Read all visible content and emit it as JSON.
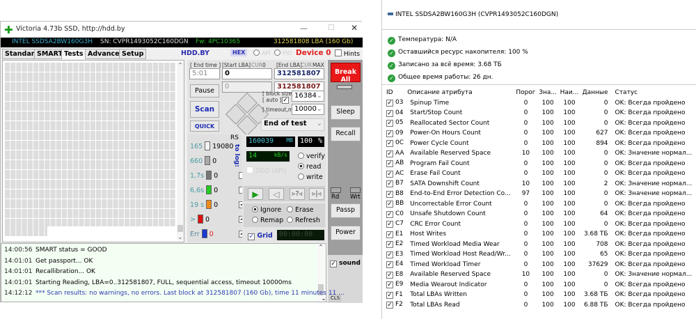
{
  "victoria": {
    "title": "Victoria 4.73b SSD, http://hdd.by",
    "info": {
      "model": "INTEL SSDSA2BW160G3H",
      "sn": "SN: CVPR1493052C160DGN",
      "fw": "Fw: 4PC10365",
      "lba": "312581808 LBA (160 Gb)"
    },
    "tabs": [
      "Standard",
      "SMART",
      "Tests",
      "Advanced",
      "Setup"
    ],
    "hddby": "HDD.BY",
    "hex": "HEX",
    "api": "API",
    "pio": "PIO",
    "device": "Device 0",
    "hints": "Hints",
    "end_time_label": "[ End time ]",
    "end_time": "5:01",
    "start_lba_label": "[Start LBA]",
    "cur": "CUR",
    "cur_val": "0",
    "end_lba_label": "[End LBA]",
    "max": "MAX",
    "start_lba": "0",
    "end_lba": "312581807",
    "start_lba2": "0",
    "end_lba2": "312581807",
    "pause": "Pause",
    "scan": "Scan",
    "quick": "QUICK",
    "block_size_label": "[ block size ]",
    "auto_label": "[ auto ]",
    "block_size": "16384",
    "timeout_label": "[ timeout,ms ]",
    "timeout": "10000",
    "end_action": "End of test",
    "rs": "RS",
    "to_log": "to log:",
    "legend": [
      {
        "label": "165",
        "count": "19080",
        "color": "#f4f4f4"
      },
      {
        "label": "660",
        "count": "0",
        "color": "#aaaaaa"
      },
      {
        "label": "1,7s",
        "count": "0",
        "color": "#777777"
      },
      {
        "label": "6,6s",
        "count": "0",
        "color": "#22cc22"
      },
      {
        "label": "19 s",
        "count": "0",
        "color": "#f08a1c"
      },
      {
        "label": ">",
        "count": "0",
        "color": "#e01010"
      },
      {
        "label": "Err",
        "count": "0",
        "color": "#1a3ad0"
      }
    ],
    "mb": "160039",
    "mb_unit": "MB",
    "pct": "100",
    "pct_unit": "%",
    "speed": "14",
    "speed_unit": "kB/s",
    "ddd": "DDD (API)",
    "modes": [
      "verify",
      "read",
      "write"
    ],
    "actions": [
      "Ignore",
      "Erase",
      "Remap",
      "Refresh"
    ],
    "grid": "Grid",
    "timer": "00:00:00",
    "break_all": "Break All",
    "sleep": "Sleep",
    "recall": "Recall",
    "rd": "Rd",
    "wrt": "Wrt",
    "passp": "Passp",
    "power": "Power",
    "sound": "sound",
    "cls": "CLS",
    "log": [
      {
        "t": "14:00:56",
        "m": "SMART status = GOOD"
      },
      {
        "t": "14:01:01",
        "m": "Get passport... OK"
      },
      {
        "t": "14:01:01",
        "m": "Recallibration... OK"
      },
      {
        "t": "14:01:01",
        "m": "Starting Reading, LBA=0..312581807, FULL, sequential access, timeout 10000ms"
      },
      {
        "t": "14:12:12",
        "m": "*** Scan results: no warnings, no errors. Last block at 312581807 (160 Gb), time 11 minutes 11 ..."
      }
    ]
  },
  "smart": {
    "drive": "INTEL SSDSA2BW160G3H (CVPR1493052C160DGN)",
    "status": [
      "Температура: N/A",
      "Оставшийся ресурс накопителя: 100 %",
      "Записано за всё время: 3.68 ТБ",
      "Общее время работы: 26 дн."
    ],
    "columns": [
      "ID",
      "Описание атрибута",
      "Порог",
      "Зна...",
      "Наи...",
      "Данные",
      "Статус"
    ],
    "rows": [
      [
        "03",
        "Spinup Time",
        "0",
        "100",
        "100",
        "0",
        "OK: Всегда пройдено"
      ],
      [
        "04",
        "Start/Stop Count",
        "0",
        "100",
        "100",
        "0",
        "OK: Всегда пройдено"
      ],
      [
        "05",
        "Reallocated Sector Count",
        "0",
        "100",
        "100",
        "0",
        "OK: Всегда пройдено"
      ],
      [
        "09",
        "Power-On Hours Count",
        "0",
        "100",
        "100",
        "627",
        "OK: Всегда пройдено"
      ],
      [
        "0C",
        "Power Cycle Count",
        "0",
        "100",
        "100",
        "894",
        "OK: Всегда пройдено"
      ],
      [
        "AA",
        "Available Reserved Space",
        "10",
        "100",
        "100",
        "0",
        "OK: Значение нормал..."
      ],
      [
        "AB",
        "Program Fail Count",
        "0",
        "100",
        "100",
        "0",
        "OK: Всегда пройдено"
      ],
      [
        "AC",
        "Erase Fail Count",
        "0",
        "100",
        "100",
        "0",
        "OK: Всегда пройдено"
      ],
      [
        "B7",
        "SATA Downshift Count",
        "10",
        "100",
        "100",
        "2",
        "OK: Значение нормал..."
      ],
      [
        "B8",
        "End-to-End Error Detection Co...",
        "97",
        "100",
        "100",
        "0",
        "OK: Значение нормал..."
      ],
      [
        "BB",
        "Uncorrectable Error Count",
        "0",
        "100",
        "100",
        "0",
        "OK: Всегда пройдено"
      ],
      [
        "C0",
        "Unsafe Shutdown Count",
        "0",
        "100",
        "100",
        "64",
        "OK: Всегда пройдено"
      ],
      [
        "C7",
        "CRC Error Count",
        "0",
        "100",
        "100",
        "0",
        "OK: Всегда пройдено"
      ],
      [
        "E1",
        "Host Writes",
        "0",
        "100",
        "100",
        "3.68 ТБ",
        "OK: Всегда пройдено"
      ],
      [
        "E2",
        "Timed Workload Media Wear",
        "0",
        "100",
        "100",
        "708",
        "OK: Всегда пройдено"
      ],
      [
        "E3",
        "Timed Workload Host Read/Wr...",
        "0",
        "100",
        "100",
        "65",
        "OK: Всегда пройдено"
      ],
      [
        "E4",
        "Timed Workload Timer",
        "0",
        "100",
        "100",
        "37629",
        "OK: Всегда пройдено"
      ],
      [
        "E8",
        "Available Reserved Space",
        "10",
        "100",
        "100",
        "0",
        "OK: Значение нормал..."
      ],
      [
        "E9",
        "Media Wearout Indicator",
        "0",
        "100",
        "100",
        "0",
        "OK: Всегда пройдено"
      ],
      [
        "F1",
        "Total LBAs Written",
        "0",
        "100",
        "100",
        "3.68 ТБ",
        "OK: Всегда пройдено"
      ],
      [
        "F2",
        "Total LBAs Read",
        "0",
        "100",
        "100",
        "6.88 ТБ",
        "OK: Всегда пройдено"
      ]
    ]
  }
}
